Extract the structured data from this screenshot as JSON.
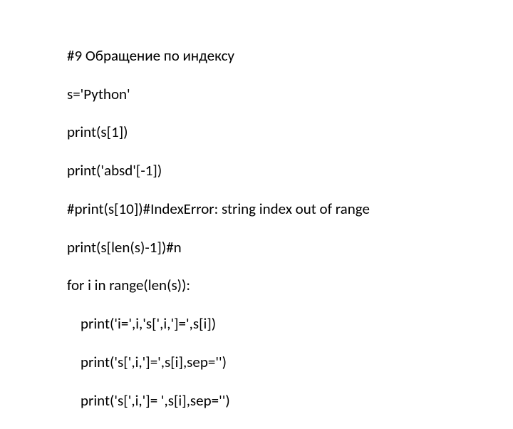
{
  "code": {
    "lines": [
      "#9 Обращение по индексу",
      "s='Python'",
      "print(s[1])",
      "print('absd'[-1])",
      "#print(s[10])#IndexError: string index out of range",
      "print(s[len(s)-1])#n",
      "for i in range(len(s)):",
      "    print('i=',i,'s[',i,']=',s[i])",
      "    print('s[',i,']=',s[i],sep='')",
      "    print('s[',i,']= ',s[i],sep='')"
    ]
  }
}
